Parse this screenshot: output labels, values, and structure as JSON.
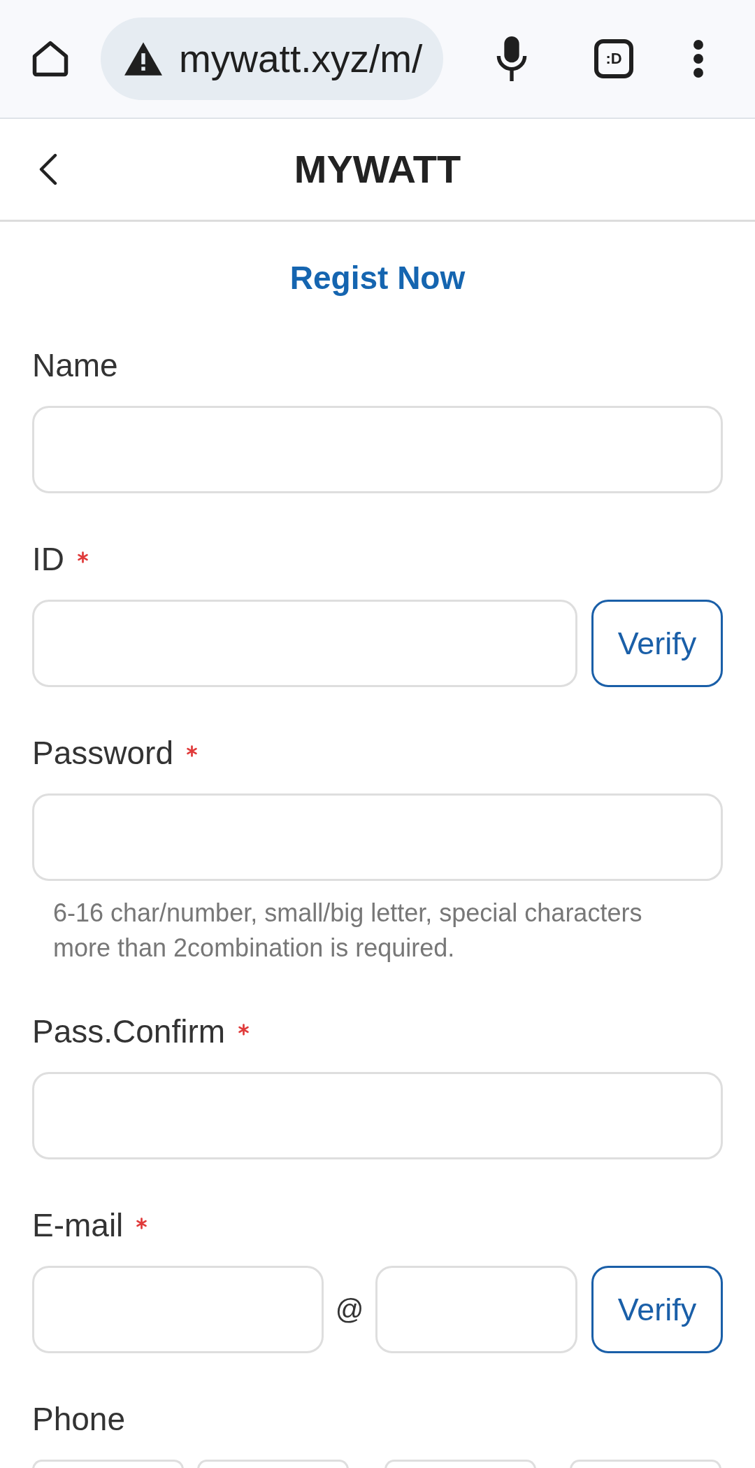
{
  "browser": {
    "url": "mywatt.xyz/m/",
    "tab_count": ":D"
  },
  "header": {
    "title": "MYWATT"
  },
  "heading": "Regist Now",
  "fields": [
    {
      "kind": "text",
      "label": "Name",
      "required": false
    },
    {
      "kind": "text_button",
      "label": "ID",
      "required": true,
      "button": "Verify"
    },
    {
      "kind": "text",
      "label": "Password",
      "required": true,
      "hint": "6-16 char/number, small/big letter, special characters more than 2combination is required."
    },
    {
      "kind": "text",
      "label": "Pass.Confirm",
      "required": true
    },
    {
      "kind": "email",
      "label": "E-mail",
      "required": true,
      "separator": "@",
      "button": "Verify"
    },
    {
      "kind": "phone",
      "label": "Phone",
      "required": false
    }
  ]
}
